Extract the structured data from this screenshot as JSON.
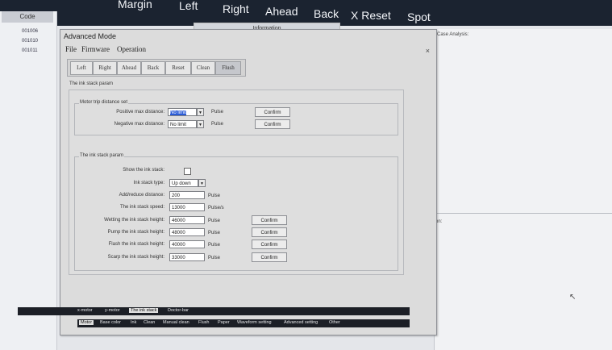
{
  "topbar": {
    "items": [
      "Margin",
      "Left",
      "Right",
      "Ahead",
      "Back",
      "X Reset",
      "Spot"
    ]
  },
  "left_panel": {
    "header": "Code",
    "rows": [
      "001006",
      "001010",
      "001011"
    ]
  },
  "info_header": "Information",
  "right_panel": {
    "case_label": "Case Analysis:",
    "solution_label": "Solution:"
  },
  "dialog": {
    "title": "Advanced Mode",
    "close": "×",
    "menu": [
      "File",
      "Firmware",
      "Operation"
    ],
    "toolbar": [
      "Left",
      "Right",
      "Ahead",
      "Back",
      "Reset",
      "Clean",
      "Flush"
    ],
    "active_tool": "Flush",
    "section_title": "The ink stack param",
    "motor_group": {
      "title": "Motor trip distance set",
      "rows": [
        {
          "label": "Positive max distance:",
          "value": "No limit",
          "unit": "Pulse",
          "button": "Confirm"
        },
        {
          "label": "Negative max distance:",
          "value": "No limit",
          "unit": "Pulse",
          "button": "Confirm"
        }
      ]
    },
    "stack_group": {
      "title": "The ink stack param",
      "show_label": "Show the ink stack:",
      "type_label": "Ink stack type:",
      "type_value": "Up down",
      "rows": [
        {
          "label": "Add/reduce distance:",
          "value": "200",
          "unit": "Pulse",
          "button": ""
        },
        {
          "label": "The ink stack speed:",
          "value": "13000",
          "unit": "Pulse/s",
          "button": ""
        },
        {
          "label": "Wetting the ink stack height:",
          "value": "46000",
          "unit": "Pulse",
          "button": "Confirm"
        },
        {
          "label": "Pump the ink stack height:",
          "value": "48000",
          "unit": "Pulse",
          "button": "Confirm"
        },
        {
          "label": "Flash the ink stack height:",
          "value": "40000",
          "unit": "Pulse",
          "button": "Confirm"
        },
        {
          "label": "Scarp the ink stack height:",
          "value": "33000",
          "unit": "Pulse",
          "button": "Confirm"
        }
      ]
    },
    "subtabs": [
      "x-motor",
      "y-motor",
      "The ink stack",
      "Doctor-bar"
    ],
    "active_subtab": "The ink stack",
    "bottom_tabs": [
      "Motor",
      "Base color",
      "Ink",
      "Clean",
      "Manual clean",
      "Flush",
      "Paper",
      "Waveform setting",
      "Advanced setting",
      "Other"
    ],
    "active_bottom_tab": "Motor"
  }
}
